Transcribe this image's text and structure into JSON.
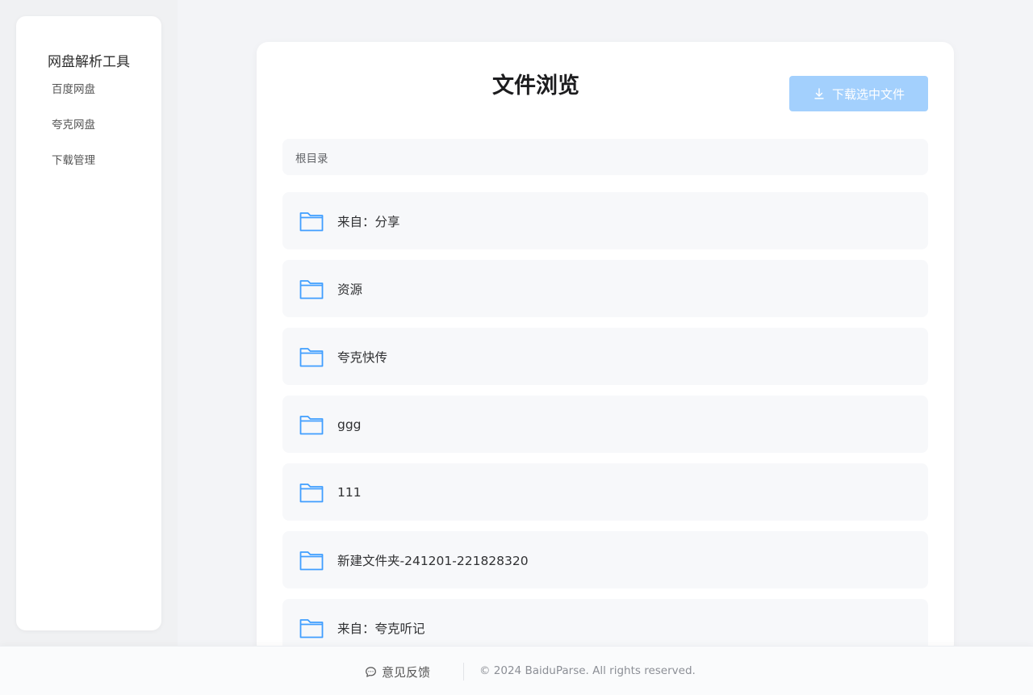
{
  "sidebar": {
    "title": "网盘解析工具",
    "items": [
      {
        "label": "百度网盘"
      },
      {
        "label": "夸克网盘"
      },
      {
        "label": "下载管理"
      }
    ]
  },
  "main": {
    "title": "文件浏览",
    "download_button": "下载选中文件",
    "breadcrumb": "根目录",
    "files": [
      {
        "name": "来自：分享",
        "icon": "folder-icon"
      },
      {
        "name": "资源",
        "icon": "folder-icon"
      },
      {
        "name": "夸克快传",
        "icon": "folder-icon"
      },
      {
        "name": "ggg",
        "icon": "folder-icon"
      },
      {
        "name": "111",
        "icon": "folder-icon"
      },
      {
        "name": "新建文件夹-241201-221828320",
        "icon": "folder-icon"
      },
      {
        "name": "来自：夸克听记",
        "icon": "folder-icon"
      }
    ]
  },
  "footer": {
    "feedback": "意见反馈",
    "copyright": "© 2024 BaiduParse. All rights reserved."
  },
  "colors": {
    "accent": "#409eff",
    "accent_disabled": "#a3d0fd",
    "background": "#f3f4f7"
  }
}
